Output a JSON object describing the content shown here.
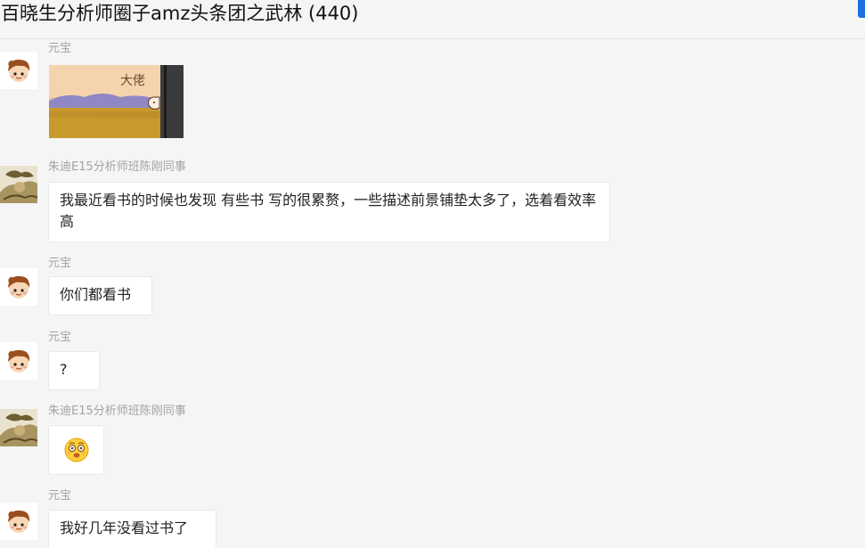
{
  "window": {
    "title": "百晓生分析师圈子amz头条团之武林 (440)"
  },
  "messages": [
    {
      "sender": "元宝",
      "type": "sticker",
      "sticker_text": "大佬"
    },
    {
      "sender": "朱迪E15分析师班陈刚同事",
      "type": "text",
      "text": "我最近看书的时候也发现 有些书 写的很累赘，一些描述前景铺垫太多了，选着看效率高"
    },
    {
      "sender": "元宝",
      "type": "text",
      "text": "你们都看书"
    },
    {
      "sender": "元宝",
      "type": "text",
      "text": "?"
    },
    {
      "sender": "朱迪E15分析师班陈刚同事",
      "type": "emoji",
      "emoji": "dizzy-face"
    },
    {
      "sender": "元宝",
      "type": "text",
      "text": "我好几年没看过书了"
    }
  ],
  "colors": {
    "background": "#f5f5f5",
    "bubble": "#ffffff",
    "sender": "#a3a3a3",
    "accent": "#1e6fe0"
  }
}
